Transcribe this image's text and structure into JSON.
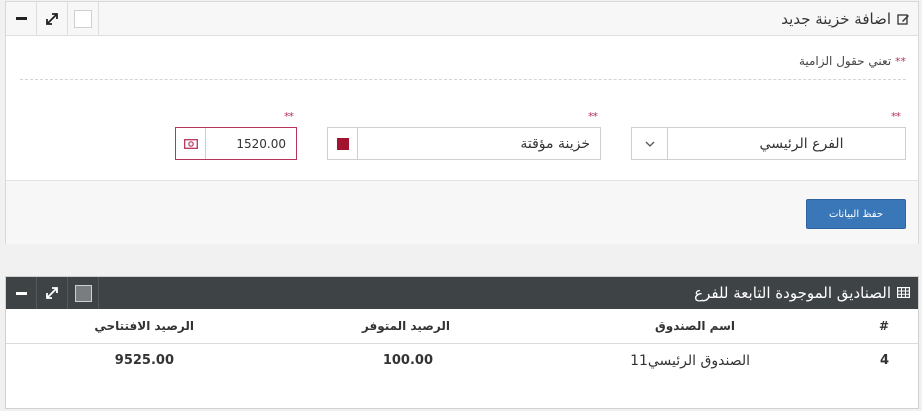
{
  "form_panel": {
    "title": "اضافة خزينة جديد",
    "required_marker": "**",
    "required_note": "تعني حقول الزامية",
    "branch_value": "الفرع الرئيسي",
    "type_value": "خزينة مؤقتة",
    "type_color": "#a31330",
    "amount_value": "1520.00",
    "save_label": "حفظ البيانات"
  },
  "table_panel": {
    "title": "الصناديق الموجودة التابعة للفرع",
    "columns": [
      "#",
      "اسم الصندوق",
      "الرصيد المتوفر",
      "الرصيد الافتتاحي"
    ],
    "rows": [
      {
        "num": "4",
        "name": "الصندوق الرئيسي11",
        "available": "100.00",
        "opening": "9525.00"
      }
    ]
  },
  "icons": [
    "edit-icon",
    "expand-icon",
    "minus-icon",
    "chevron-down-icon",
    "money-icon",
    "table-icon"
  ],
  "colors": {
    "accent": "#3a77b8",
    "required": "#b8345b",
    "dark_header": "#3e4346"
  }
}
